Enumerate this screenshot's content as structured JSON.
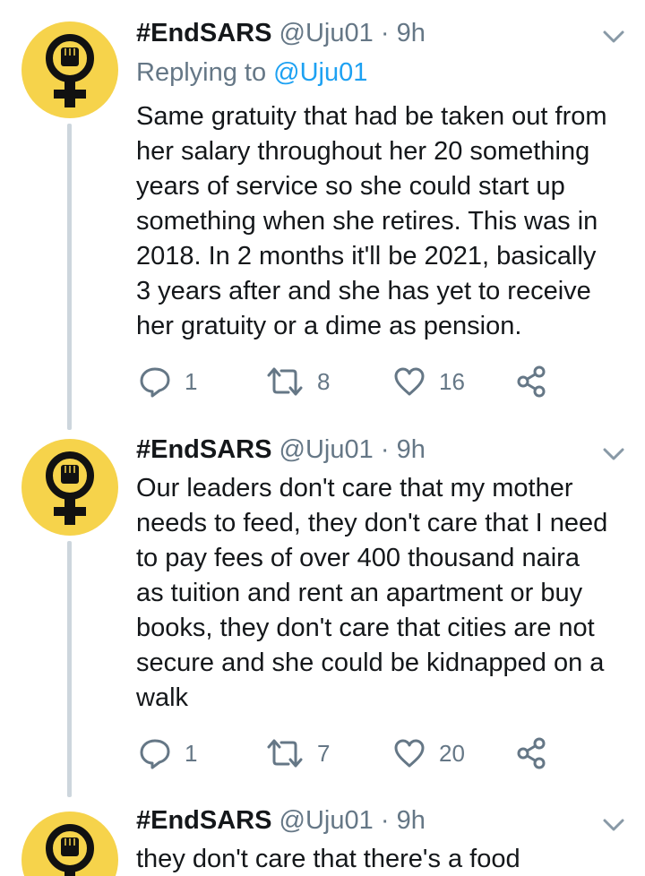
{
  "tweets": [
    {
      "name": "#EndSARS",
      "handle": "@Uju01",
      "dot": "·",
      "time": "9h",
      "reply_prefix": "Replying to",
      "reply_to": "@Uju01",
      "text": "Same gratuity that had be taken out from\nher salary throughout her 20 something\nyears of service so she could start up\nsomething when she retires. This was in\n2018. In 2 months it'll be 2021, basically\n3 years after and she has yet to receive\nher gratuity or a dime as pension.",
      "replies": "1",
      "retweets": "8",
      "likes": "16"
    },
    {
      "name": "#EndSARS",
      "handle": "@Uju01",
      "dot": "·",
      "time": "9h",
      "text": "Our leaders don't care that my mother\nneeds to feed, they don't care that I need\nto pay fees of over 400 thousand naira\nas tuition and rent an apartment or buy\nbooks, they don't care that cities are not\nsecure and she could be kidnapped on a\nwalk",
      "replies": "1",
      "retweets": "7",
      "likes": "20"
    },
    {
      "name": "#EndSARS",
      "handle": "@Uju01",
      "dot": "·",
      "time": "9h",
      "text": "they don't care that there's a food"
    }
  ],
  "icons": {
    "avatar": "raised-fist-female-symbol-icon",
    "menu": "chevron-down-icon",
    "reply": "reply-bubble-icon",
    "retweet": "retweet-icon",
    "like": "heart-icon",
    "share": "share-icon"
  },
  "colors": {
    "avatar_bg": "#f6d34b",
    "mention": "#1da1f2",
    "muted": "#657786",
    "thread_line": "#cdd6dd"
  }
}
